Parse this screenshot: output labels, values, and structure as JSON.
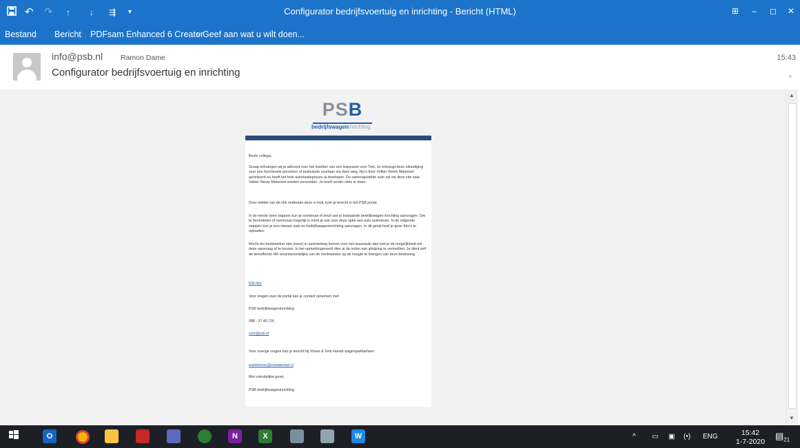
{
  "window": {
    "title": "Configurator bedrijfsvoertuig en inrichting - Bericht (HTML)",
    "controls": {
      "restore": "⊞",
      "minimize": "–",
      "maximize": "◻",
      "close": "✕"
    }
  },
  "ribbon": {
    "tabs": [
      "Bestand",
      "Bericht",
      "PDFsam Enhanced 6 Creator"
    ],
    "tellme": "Geef aan wat u wilt doen..."
  },
  "header": {
    "from": "info@psb.nl",
    "to": "Ramon Dame",
    "subject": "Configurator bedrijfsvoertuig en inrichting",
    "time": "15:43"
  },
  "message": {
    "logo": {
      "text_p": "P",
      "text_s": "S",
      "text_b": "B",
      "sub_a": "bedrijfswagen",
      "sub_b": "inrichting"
    },
    "greeting": "Beste collega,",
    "p1": "Graag ontvangen wij je akkoord voor het inzetten van een leaseauto voor Test. Je ontvangt deze uitnodiging voor een functionele personen of bestelauto voortaan via deze weg. Hij is door Volker Stevin Materieel geïnitieerd en heeft het hele autorisatieproces al doorlopen. De samengestelde auto zal via deze site naar Volker Stevin Materieel worden verzonden. Je hoeft verder niets te doen.",
    "p2": "Door middel van de link onderaan deze e-mail, kom je terecht in het PSB portal.",
    "p3": "In de eerste twee stappen kun je overbouw of inruil van je bestaande bedrijfswagen inrichting aanvragen. Om te beoordelen of overbouw mogelijk is moet je ook voor deze optie een auto selecteren. In de volgende stappen kun je een nieuwe auto en bedrijfswageninrichting aanvragen. In dit geval hoef je geen foto's te uploaden.",
    "p4": "Mocht de medewerker niet (meer) in aanmerking komen voor een leaseauto dan heb je de mogelijkheid om deze aanvraag af te keuren. In het opmerkingenveld dien je de reden van afwijzing te vermelden. Je dient zelf de betreffende HR verantwoordelijke van de medewerker op de hoogte te brengen van deze beslissing.",
    "link": "Klik hier",
    "contact_intro": "Voor vragen over de portal kan je contact opnemen met:",
    "contact_name": "PSB bedrijfswageninrichting",
    "contact_phone": "088 - 37 40 716",
    "contact_email": "vsm@psb.nl",
    "other": "Voor overige vragen kan je terecht bij Visser & Smit Hanab wagenparkbeheer:",
    "other_email": "autobeheer@vsmaterieel.nl",
    "closing": "Met vriendelijke groet,",
    "signature": "PSB bedrijfswageninrichting"
  },
  "taskbar": {
    "apps": [
      "start-icon",
      "outlook-icon",
      "chrome-icon",
      "explorer-icon",
      "app-red-icon",
      "network-app-icon",
      "green-app-icon",
      "onenote-icon",
      "excel-icon",
      "app-gear-icon",
      "app-pencil-icon",
      "word-icon"
    ],
    "app_labels": {
      "outlook": "O",
      "onenote": "N",
      "excel": "X",
      "word": "W"
    },
    "tray": {
      "chevron": "^",
      "lang": "ENG",
      "sound": "(•)"
    },
    "clock": {
      "time": "15:42",
      "date": "1-7-2020"
    },
    "notifications": "21"
  }
}
